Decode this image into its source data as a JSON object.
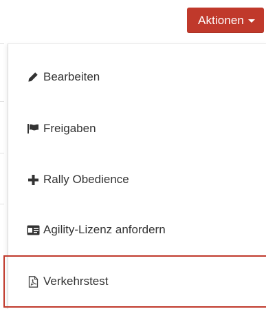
{
  "header": {
    "actions_label": "Aktionen",
    "accent_color": "#c0392b"
  },
  "menu": {
    "items": [
      {
        "label": "Bearbeiten",
        "icon": "pencil-icon"
      },
      {
        "label": "Freigaben",
        "icon": "flag-icon"
      },
      {
        "label": "Rally Obedience",
        "icon": "plus-icon"
      },
      {
        "label": "Agility-Lizenz anfordern",
        "icon": "id-card-icon"
      },
      {
        "label": "Verkehrstest",
        "icon": "pdf-file-icon",
        "highlighted": true
      }
    ],
    "highlight_color": "#c0392b"
  }
}
